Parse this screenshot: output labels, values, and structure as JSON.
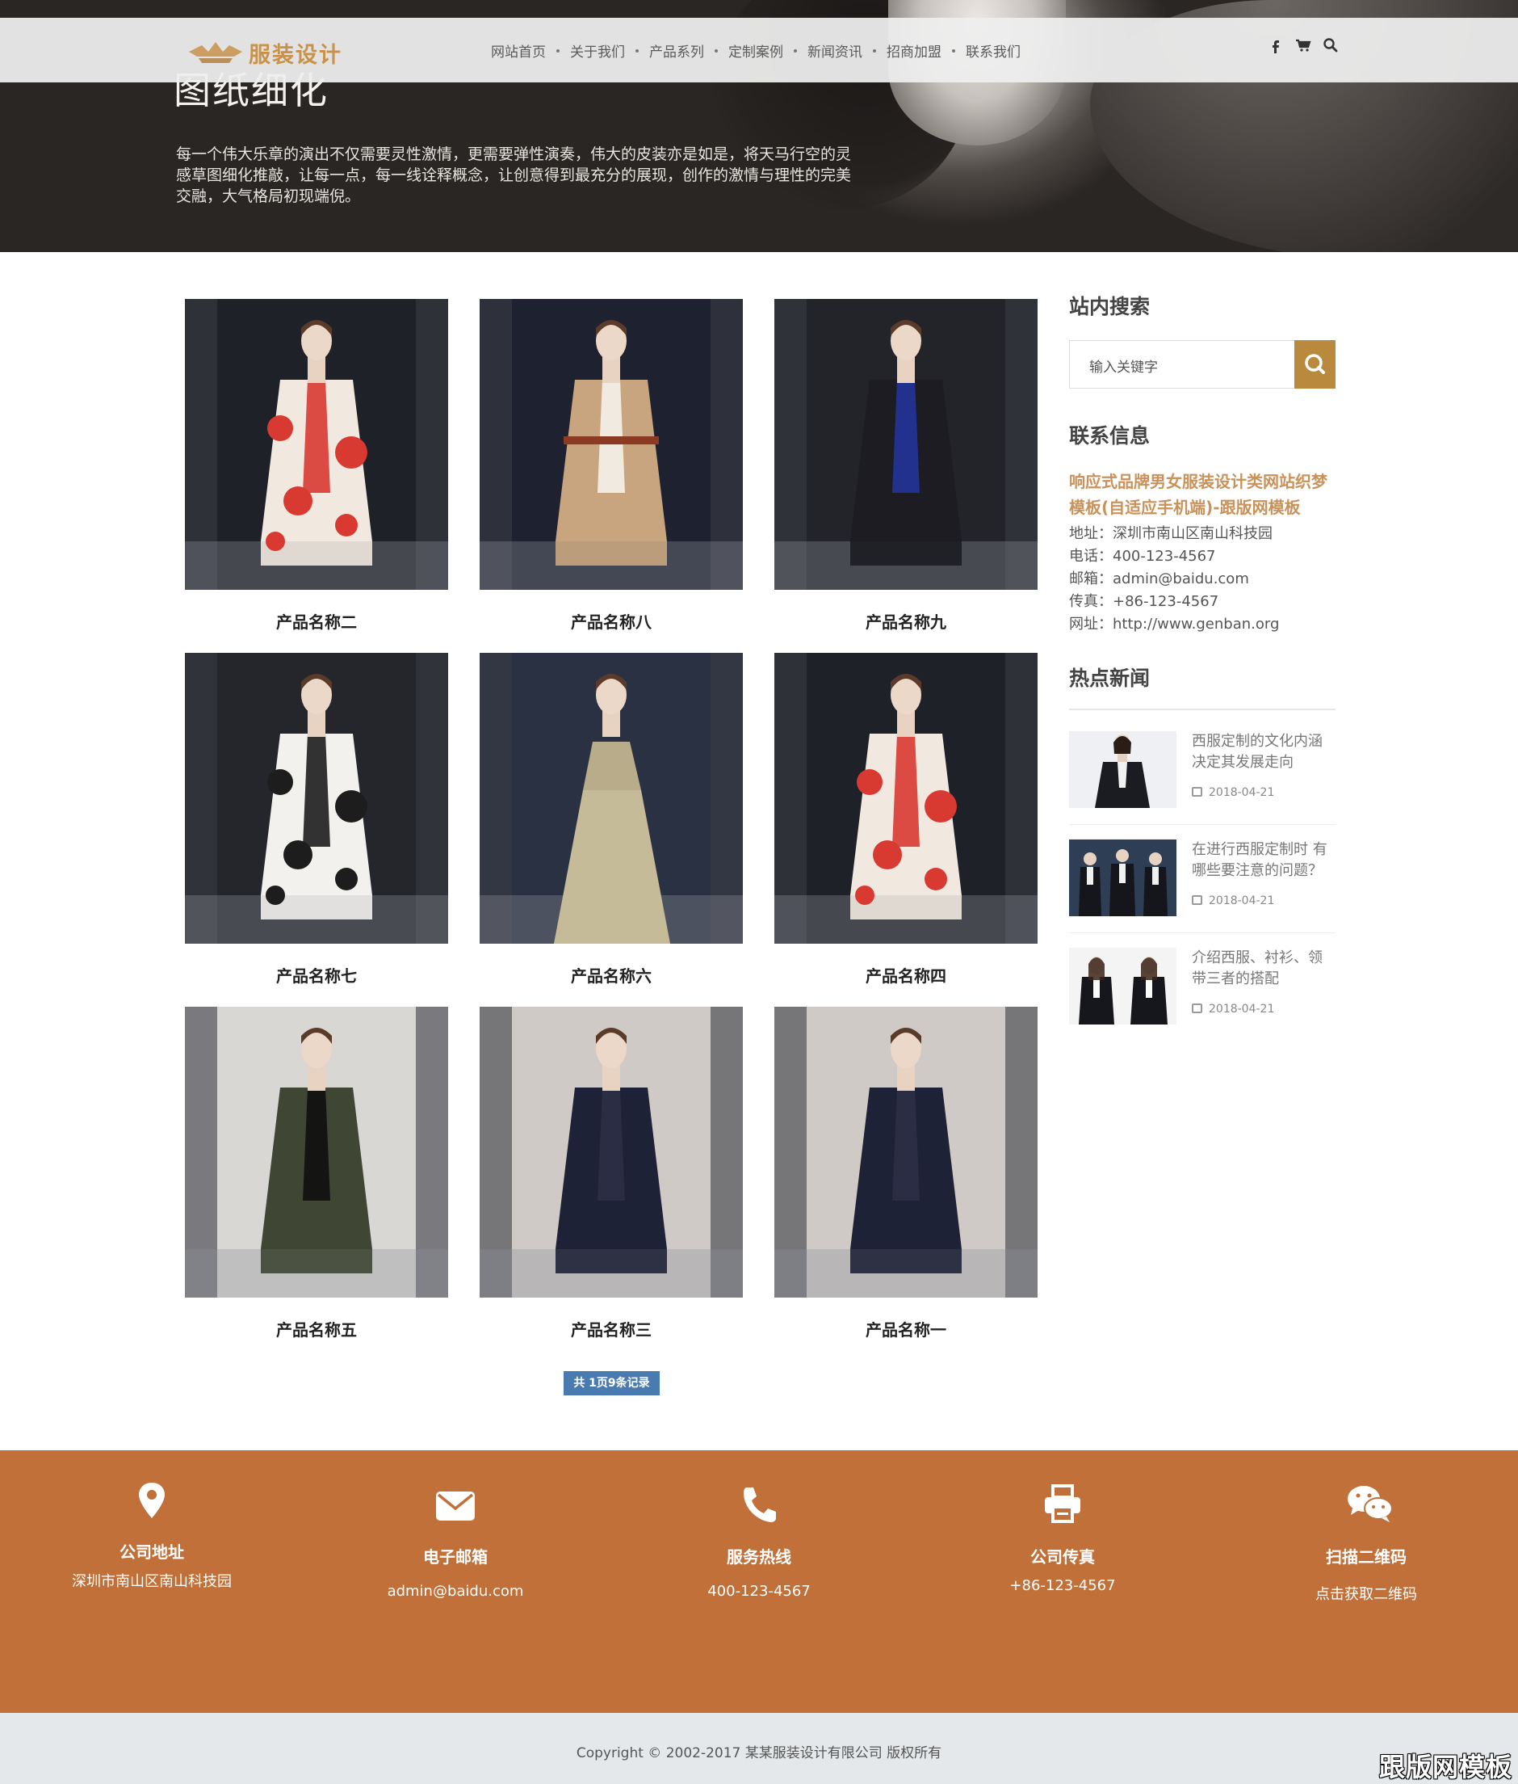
{
  "brand": {
    "logo_text": "服装设计",
    "accent": "#c8924a"
  },
  "nav": {
    "items": [
      "网站首页",
      "关于我们",
      "产品系列",
      "定制案例",
      "新闻资讯",
      "招商加盟",
      "联系我们"
    ]
  },
  "header_icons": [
    "facebook-icon",
    "cart-icon",
    "search-icon"
  ],
  "hero": {
    "title": "图纸细化",
    "desc": "每一个伟大乐章的演出不仅需要灵性激情，更需要弹性演奏，伟大的皮装亦是如是，将天马行空的灵感草图细化推敲，让每一点，每一线诠释概念，让创意得到最充分的展现，创作的激情与理性的完美交融，大气格局初现端倪。"
  },
  "products": [
    {
      "name": "产品名称二",
      "style": "polka"
    },
    {
      "name": "产品名称八",
      "style": "camel"
    },
    {
      "name": "产品名称九",
      "style": "navyfur"
    },
    {
      "name": "产品名称七",
      "style": "whiteblack"
    },
    {
      "name": "产品名称六",
      "style": "gown"
    },
    {
      "name": "产品名称四",
      "style": "polka"
    },
    {
      "name": "产品名称五",
      "style": "green"
    },
    {
      "name": "产品名称三",
      "style": "navycoat"
    },
    {
      "name": "产品名称一",
      "style": "navycoat"
    }
  ],
  "pager": {
    "text": "共 1页9条记录"
  },
  "sidebar": {
    "search_title": "站内搜索",
    "search_placeholder": "输入关键字",
    "contact_title": "联系信息",
    "company": "响应式品牌男女服装设计类网站织梦模板(自适应手机端)-跟版网模板",
    "info": [
      {
        "label": "地址：",
        "value": "深圳市南山区南山科技园"
      },
      {
        "label": "电话：",
        "value": "400-123-4567"
      },
      {
        "label": "邮箱：",
        "value": "admin@baidu.com"
      },
      {
        "label": "传真：",
        "value": "+86-123-4567"
      },
      {
        "label": "网址：",
        "value": "http://www.genban.org"
      }
    ],
    "news_title": "热点新闻",
    "news": [
      {
        "title": "西服定制的文化内涵决定其发展走向",
        "date": "2018-04-21"
      },
      {
        "title": "在进行西服定制时 有哪些要注意的问题？",
        "date": "2018-04-21"
      },
      {
        "title": "介绍西服、衬衫、领带三者的搭配",
        "date": "2018-04-21"
      }
    ]
  },
  "footer": {
    "bg": "#c07038",
    "cols": [
      {
        "icon": "location-pin-icon",
        "label": "公司地址",
        "value": "深圳市南山区南山科技园"
      },
      {
        "icon": "envelope-icon",
        "label": "电子邮箱",
        "value": "admin@baidu.com"
      },
      {
        "icon": "phone-icon",
        "label": "服务热线",
        "value": "400-123-4567"
      },
      {
        "icon": "printer-icon",
        "label": "公司传真",
        "value": "+86-123-4567"
      },
      {
        "icon": "wechat-icon",
        "label": "扫描二维码",
        "value": "点击获取二维码"
      }
    ],
    "copyright": "Copyright © 2002-2017 某某服装设计有限公司 版权所有",
    "watermark": "跟版网模板"
  }
}
